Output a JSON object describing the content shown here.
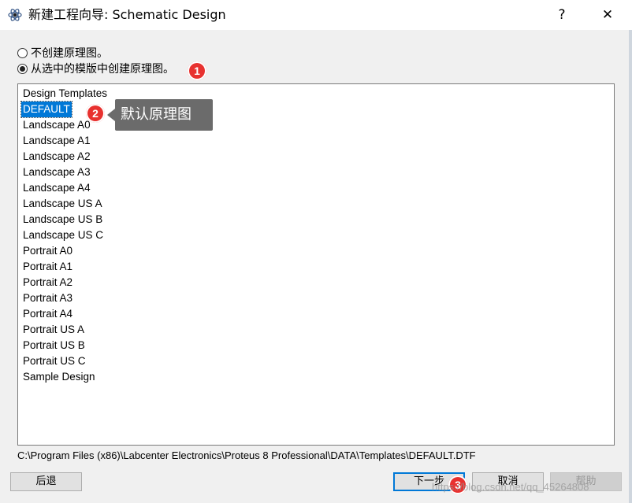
{
  "window": {
    "title": "新建工程向导: Schematic Design",
    "help_glyph": "?",
    "close_glyph": "✕"
  },
  "options": [
    {
      "label": "不创建原理图。",
      "checked": false
    },
    {
      "label": "从选中的模版中创建原理图。",
      "checked": true
    }
  ],
  "annotations": {
    "badge1": "1",
    "badge2": "2",
    "badge3": "3",
    "tooltip": "默认原理图"
  },
  "list": {
    "items": [
      "Design Templates",
      "DEFAULT",
      "Landscape A0",
      "Landscape A1",
      "Landscape A2",
      "Landscape A3",
      "Landscape A4",
      "Landscape US A",
      "Landscape US B",
      "Landscape US C",
      "Portrait A0",
      "Portrait A1",
      "Portrait A2",
      "Portrait A3",
      "Portrait A4",
      "Portrait US A",
      "Portrait US B",
      "Portrait US C",
      "Sample Design"
    ],
    "selected_index": 1
  },
  "path": "C:\\Program Files (x86)\\Labcenter Electronics\\Proteus 8 Professional\\DATA\\Templates\\DEFAULT.DTF",
  "buttons": {
    "back": "后退",
    "next": "下一步",
    "cancel": "取消",
    "help": "帮助"
  },
  "watermark": "https://blog.csdn.net/qq_45264808",
  "colors": {
    "selection": "#0078d7",
    "badge": "#e8312f",
    "tooltip_bg": "#6b6b6b"
  }
}
